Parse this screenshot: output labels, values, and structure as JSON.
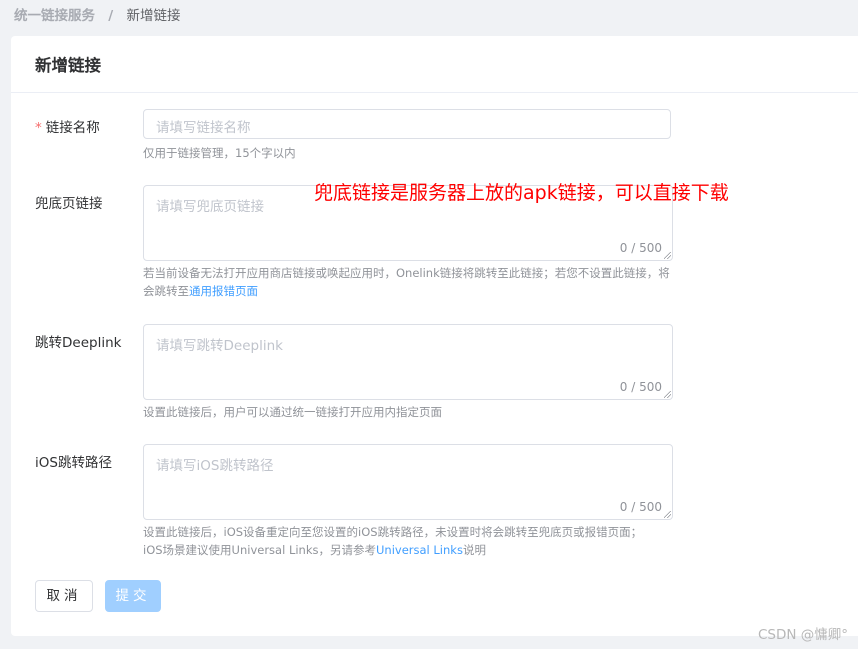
{
  "breadcrumb": {
    "parent": "统一链接服务",
    "separator": "/",
    "current": "新增链接"
  },
  "card": {
    "title": "新增链接"
  },
  "form": {
    "name": {
      "required_mark": "*",
      "label": "链接名称",
      "placeholder": "请填写链接名称",
      "help": "仅用于链接管理，15个字以内"
    },
    "fallback": {
      "label": "兜底页链接",
      "placeholder": "请填写兜底页链接",
      "counter": "0 / 500",
      "help_text": "若当前设备无法打开应用商店链接或唤起应用时，Onelink链接将跳转至此链接；若您不设置此链接，将会跳转至",
      "help_link": "通用报错页面"
    },
    "deeplink": {
      "label": "跳转Deeplink",
      "placeholder": "请填写跳转Deeplink",
      "counter": "0 / 500",
      "help": "设置此链接后，用户可以通过统一链接打开应用内指定页面"
    },
    "ios_path": {
      "label": "iOS跳转路径",
      "placeholder": "请填写iOS跳转路径",
      "counter": "0 / 500",
      "help_line1": "设置此链接后，iOS设备重定向至您设置的iOS跳转路径，未设置时将会跳转至兜底页或报错页面；",
      "help_line2_prefix": "iOS场景建议使用Universal Links，另请参考",
      "help_link": "Universal Links",
      "help_line2_suffix": "说明"
    }
  },
  "annotation": "兜底链接是服务器上放的apk链接，可以直接下载",
  "buttons": {
    "cancel": "取消",
    "submit": "提交"
  },
  "watermark": "CSDN @慵卿°",
  "colors": {
    "required": "#f56c6c",
    "link": "#409eff",
    "submit_disabled": "#a0cfff",
    "annotation": "#ff0000"
  }
}
